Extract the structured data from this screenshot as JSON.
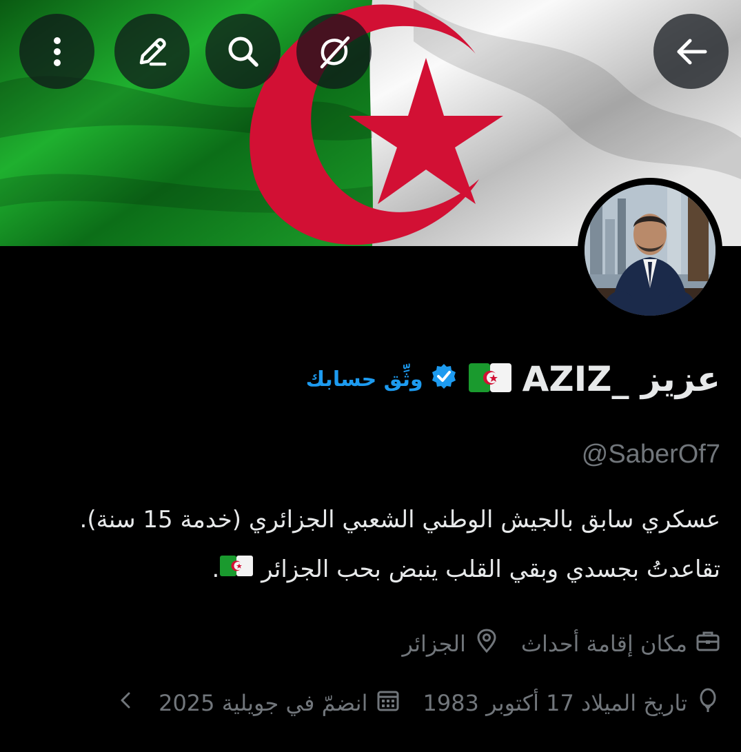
{
  "header": {
    "more_icon": "more-vertical-icon",
    "edit_icon": "pencil-icon",
    "search_icon": "search-icon",
    "grok_icon": "grok-icon",
    "back_icon": "arrow-left-icon"
  },
  "banner": {
    "subject": "flag"
  },
  "profile": {
    "display_name": "عزيز _AZIZ",
    "verify_cta": "وثِّق حسابك",
    "handle": "@SaberOf7",
    "bio_line_1": "عسكري سابق بالجيش الوطني الشعبي الجزائري (خدمة 15 سنة).",
    "bio_line_2": "تقاعدتُ بجسدي وبقي القلب ينبض بحب الجزائر",
    "bio_line_2_end": ".",
    "category": "مكان إقامة أحداث",
    "location": "الجزائر",
    "birth_date": "تاريخ الميلاد 17 أكتوبر 1983",
    "joined": "انضمّ في جويلية 2025"
  },
  "colors": {
    "accent": "#1d9bf0",
    "secondary_text": "#71767b",
    "primary_text": "#e7e9ea",
    "background": "#000000",
    "flag_green": "#1a9a2e",
    "flag_red": "#d21034"
  }
}
